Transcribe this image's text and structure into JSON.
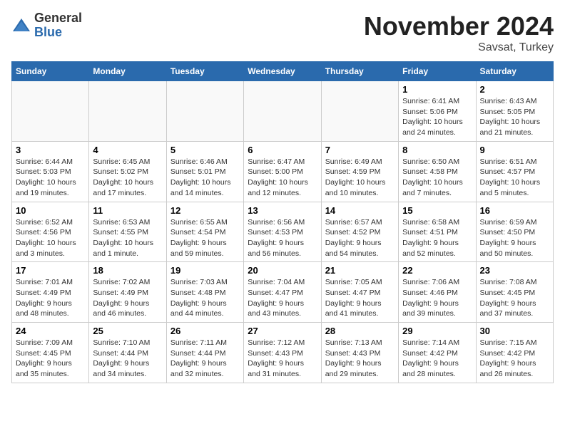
{
  "header": {
    "logo_general": "General",
    "logo_blue": "Blue",
    "month": "November 2024",
    "location": "Savsat, Turkey"
  },
  "days_of_week": [
    "Sunday",
    "Monday",
    "Tuesday",
    "Wednesday",
    "Thursday",
    "Friday",
    "Saturday"
  ],
  "weeks": [
    [
      {
        "day": "",
        "info": ""
      },
      {
        "day": "",
        "info": ""
      },
      {
        "day": "",
        "info": ""
      },
      {
        "day": "",
        "info": ""
      },
      {
        "day": "",
        "info": ""
      },
      {
        "day": "1",
        "info": "Sunrise: 6:41 AM\nSunset: 5:06 PM\nDaylight: 10 hours\nand 24 minutes."
      },
      {
        "day": "2",
        "info": "Sunrise: 6:43 AM\nSunset: 5:05 PM\nDaylight: 10 hours\nand 21 minutes."
      }
    ],
    [
      {
        "day": "3",
        "info": "Sunrise: 6:44 AM\nSunset: 5:03 PM\nDaylight: 10 hours\nand 19 minutes."
      },
      {
        "day": "4",
        "info": "Sunrise: 6:45 AM\nSunset: 5:02 PM\nDaylight: 10 hours\nand 17 minutes."
      },
      {
        "day": "5",
        "info": "Sunrise: 6:46 AM\nSunset: 5:01 PM\nDaylight: 10 hours\nand 14 minutes."
      },
      {
        "day": "6",
        "info": "Sunrise: 6:47 AM\nSunset: 5:00 PM\nDaylight: 10 hours\nand 12 minutes."
      },
      {
        "day": "7",
        "info": "Sunrise: 6:49 AM\nSunset: 4:59 PM\nDaylight: 10 hours\nand 10 minutes."
      },
      {
        "day": "8",
        "info": "Sunrise: 6:50 AM\nSunset: 4:58 PM\nDaylight: 10 hours\nand 7 minutes."
      },
      {
        "day": "9",
        "info": "Sunrise: 6:51 AM\nSunset: 4:57 PM\nDaylight: 10 hours\nand 5 minutes."
      }
    ],
    [
      {
        "day": "10",
        "info": "Sunrise: 6:52 AM\nSunset: 4:56 PM\nDaylight: 10 hours\nand 3 minutes."
      },
      {
        "day": "11",
        "info": "Sunrise: 6:53 AM\nSunset: 4:55 PM\nDaylight: 10 hours\nand 1 minute."
      },
      {
        "day": "12",
        "info": "Sunrise: 6:55 AM\nSunset: 4:54 PM\nDaylight: 9 hours\nand 59 minutes."
      },
      {
        "day": "13",
        "info": "Sunrise: 6:56 AM\nSunset: 4:53 PM\nDaylight: 9 hours\nand 56 minutes."
      },
      {
        "day": "14",
        "info": "Sunrise: 6:57 AM\nSunset: 4:52 PM\nDaylight: 9 hours\nand 54 minutes."
      },
      {
        "day": "15",
        "info": "Sunrise: 6:58 AM\nSunset: 4:51 PM\nDaylight: 9 hours\nand 52 minutes."
      },
      {
        "day": "16",
        "info": "Sunrise: 6:59 AM\nSunset: 4:50 PM\nDaylight: 9 hours\nand 50 minutes."
      }
    ],
    [
      {
        "day": "17",
        "info": "Sunrise: 7:01 AM\nSunset: 4:49 PM\nDaylight: 9 hours\nand 48 minutes."
      },
      {
        "day": "18",
        "info": "Sunrise: 7:02 AM\nSunset: 4:49 PM\nDaylight: 9 hours\nand 46 minutes."
      },
      {
        "day": "19",
        "info": "Sunrise: 7:03 AM\nSunset: 4:48 PM\nDaylight: 9 hours\nand 44 minutes."
      },
      {
        "day": "20",
        "info": "Sunrise: 7:04 AM\nSunset: 4:47 PM\nDaylight: 9 hours\nand 43 minutes."
      },
      {
        "day": "21",
        "info": "Sunrise: 7:05 AM\nSunset: 4:47 PM\nDaylight: 9 hours\nand 41 minutes."
      },
      {
        "day": "22",
        "info": "Sunrise: 7:06 AM\nSunset: 4:46 PM\nDaylight: 9 hours\nand 39 minutes."
      },
      {
        "day": "23",
        "info": "Sunrise: 7:08 AM\nSunset: 4:45 PM\nDaylight: 9 hours\nand 37 minutes."
      }
    ],
    [
      {
        "day": "24",
        "info": "Sunrise: 7:09 AM\nSunset: 4:45 PM\nDaylight: 9 hours\nand 35 minutes."
      },
      {
        "day": "25",
        "info": "Sunrise: 7:10 AM\nSunset: 4:44 PM\nDaylight: 9 hours\nand 34 minutes."
      },
      {
        "day": "26",
        "info": "Sunrise: 7:11 AM\nSunset: 4:44 PM\nDaylight: 9 hours\nand 32 minutes."
      },
      {
        "day": "27",
        "info": "Sunrise: 7:12 AM\nSunset: 4:43 PM\nDaylight: 9 hours\nand 31 minutes."
      },
      {
        "day": "28",
        "info": "Sunrise: 7:13 AM\nSunset: 4:43 PM\nDaylight: 9 hours\nand 29 minutes."
      },
      {
        "day": "29",
        "info": "Sunrise: 7:14 AM\nSunset: 4:42 PM\nDaylight: 9 hours\nand 28 minutes."
      },
      {
        "day": "30",
        "info": "Sunrise: 7:15 AM\nSunset: 4:42 PM\nDaylight: 9 hours\nand 26 minutes."
      }
    ]
  ]
}
